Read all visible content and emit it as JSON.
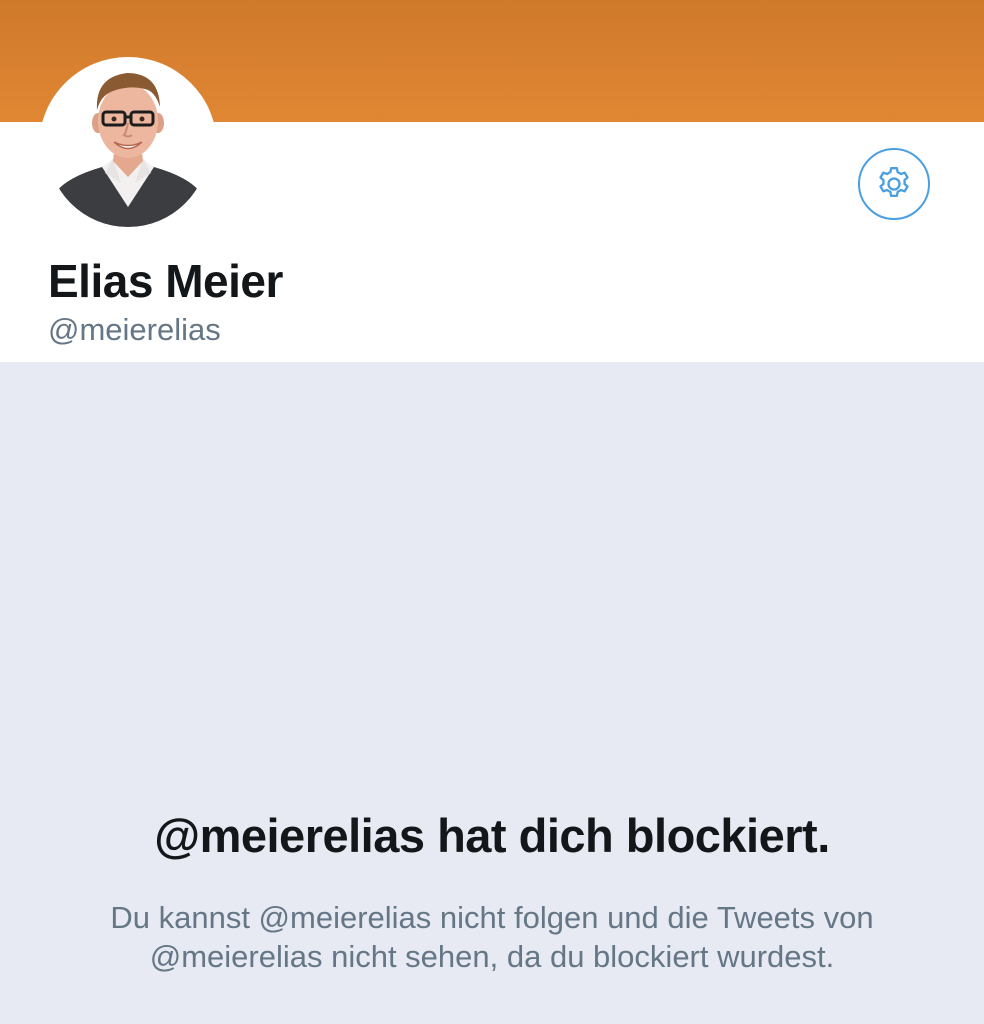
{
  "colors": {
    "banner_top": "#cf7a2c",
    "banner_bottom": "#e08633",
    "accent": "#4a9fe0",
    "background": "#e7eaf2",
    "primary_text": "#14171a",
    "secondary_text": "#657786"
  },
  "profile": {
    "display_name": "Elias Meier",
    "handle": "@meierelias",
    "avatar_icon": "profile-photo",
    "settings_icon": "gear-icon"
  },
  "blocked": {
    "title": "@meierelias hat dich blockiert.",
    "message": "Du kannst @meierelias nicht folgen und die Tweets von @meierelias nicht sehen, da du blockiert wurdest."
  }
}
